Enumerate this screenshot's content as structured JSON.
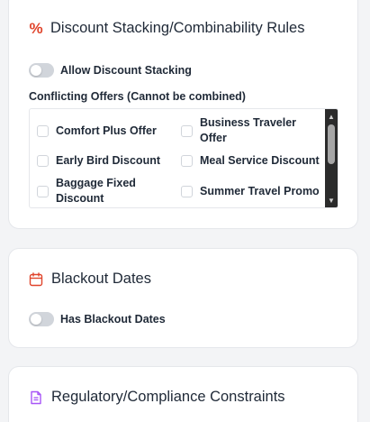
{
  "discount_card": {
    "title": "Discount Stacking/Combinability Rules",
    "icon": "percent-icon",
    "allow_stacking_label": "Allow Discount Stacking",
    "allow_stacking_enabled": false,
    "conflicting_label": "Conflicting Offers (Cannot be combined)",
    "offers": [
      {
        "label": "Comfort Plus Offer",
        "checked": false
      },
      {
        "label": "Business Traveler Offer",
        "checked": false
      },
      {
        "label": "Early Bird Discount",
        "checked": false
      },
      {
        "label": "Meal Service Discount",
        "checked": false
      },
      {
        "label": "Baggage Fixed Discount",
        "checked": false
      },
      {
        "label": "Summer Travel Promo",
        "checked": false
      }
    ]
  },
  "blackout_card": {
    "title": "Blackout Dates",
    "icon": "calendar-icon",
    "toggle_label": "Has Blackout Dates",
    "toggle_enabled": false
  },
  "regulatory_card": {
    "title": "Regulatory/Compliance Constraints",
    "icon": "document-icon"
  },
  "colors": {
    "percent_icon": "#e0452c",
    "calendar_icon": "#e0452c",
    "document_icon": "#a855f7",
    "toggle_off": "#d1d5db",
    "scrollbar_track": "#2b2b2b",
    "scrollbar_thumb": "#a6a6a6"
  }
}
